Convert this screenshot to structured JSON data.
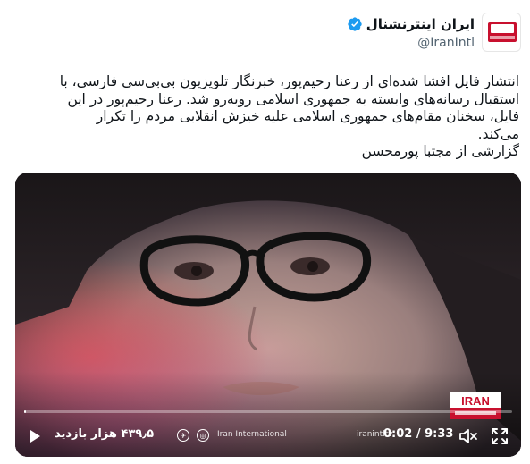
{
  "author": {
    "display_name": "ایران اینترنشنال",
    "handle": "@IranIntl",
    "verified": true,
    "avatar_icon": "iran-international-logo"
  },
  "tweet": {
    "lines": [
      "انتشار فایل افشا شده‌ای از رعنا رحیم‌پور، خبرنگار تلویزیون بی‌بی‌سی فارسی، با",
      "استقبال رسانه‌های وابسته به جمهوری اسلامی روبه‌رو شد. رعنا رحیم‌پور در این",
      "فایل، سخنان مقام‌های جمهوری اسلامی علیه خیزش انقلابی مردم را تکرار",
      "می‌کند.",
      "گزارشی از مجتبا پورمحسن"
    ]
  },
  "video": {
    "brand_badge": "IRAN International",
    "progress_fraction": 0.0037,
    "views": "۴۳۹٫۵ هزار بازدید",
    "watermark_left": "Iran International",
    "watermark_right": "iranintltv",
    "time": "0:02 / 9:33",
    "icons": [
      "play-icon",
      "instagram-icon",
      "twitter-icon",
      "telegram-icon",
      "youtube-icon",
      "mute-icon",
      "fullscreen-icon"
    ]
  },
  "colors": {
    "accent": "#1d9bf0",
    "brand_red": "#c8102e",
    "text": "#0f1419",
    "secondary": "#536471"
  }
}
